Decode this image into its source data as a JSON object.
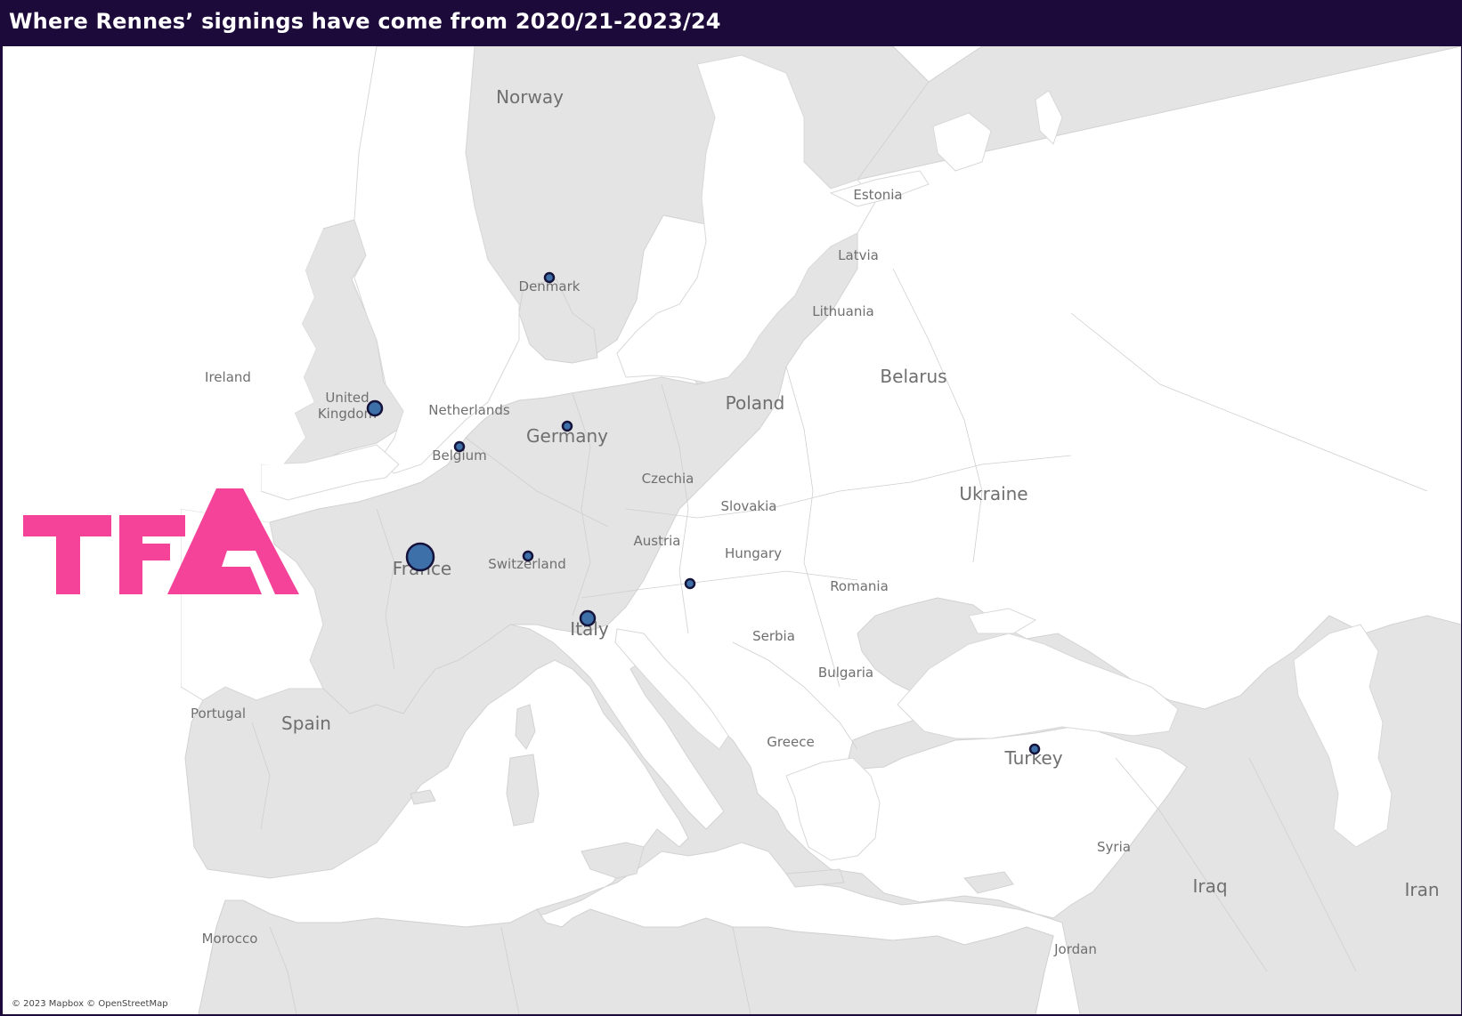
{
  "title": "Where Rennes’ signings have come from 2020/21-2023/24",
  "attribution": "© 2023 Mapbox © OpenStreetMap",
  "logo_text": "TFA",
  "colors": {
    "header_bg": "#1c0a3a",
    "land": "#e4e4e4",
    "water": "#ffffff",
    "bubble_fill": "#3d6fa8",
    "bubble_stroke": "#15133c",
    "logo": "#f5439a"
  },
  "country_labels": [
    {
      "name": "Norway"
    },
    {
      "name": "Estonia"
    },
    {
      "name": "Latvia"
    },
    {
      "name": "Denmark"
    },
    {
      "name": "Lithuania"
    },
    {
      "name": "Ireland"
    },
    {
      "name": "United Kingdom"
    },
    {
      "name": "Belarus"
    },
    {
      "name": "Netherlands"
    },
    {
      "name": "Poland"
    },
    {
      "name": "Germany"
    },
    {
      "name": "Belgium"
    },
    {
      "name": "Czechia"
    },
    {
      "name": "Ukraine"
    },
    {
      "name": "Slovakia"
    },
    {
      "name": "Austria"
    },
    {
      "name": "Hungary"
    },
    {
      "name": "France"
    },
    {
      "name": "Switzerland"
    },
    {
      "name": "Romania"
    },
    {
      "name": "Italy"
    },
    {
      "name": "Serbia"
    },
    {
      "name": "Bulgaria"
    },
    {
      "name": "Portugal"
    },
    {
      "name": "Spain"
    },
    {
      "name": "Greece"
    },
    {
      "name": "Turkey"
    },
    {
      "name": "Syria"
    },
    {
      "name": "Iraq"
    },
    {
      "name": "Iran"
    },
    {
      "name": "Morocco"
    },
    {
      "name": "Jordan"
    }
  ],
  "bubbles": [
    {
      "country": "France",
      "size": "large"
    },
    {
      "country": "United Kingdom",
      "size": "medium"
    },
    {
      "country": "Italy",
      "size": "medium"
    },
    {
      "country": "Belgium",
      "size": "small"
    },
    {
      "country": "Turkey",
      "size": "small"
    },
    {
      "country": "Denmark",
      "size": "small"
    },
    {
      "country": "Germany",
      "size": "small"
    },
    {
      "country": "Switzerland",
      "size": "small"
    },
    {
      "country": "Croatia",
      "size": "small"
    }
  ]
}
